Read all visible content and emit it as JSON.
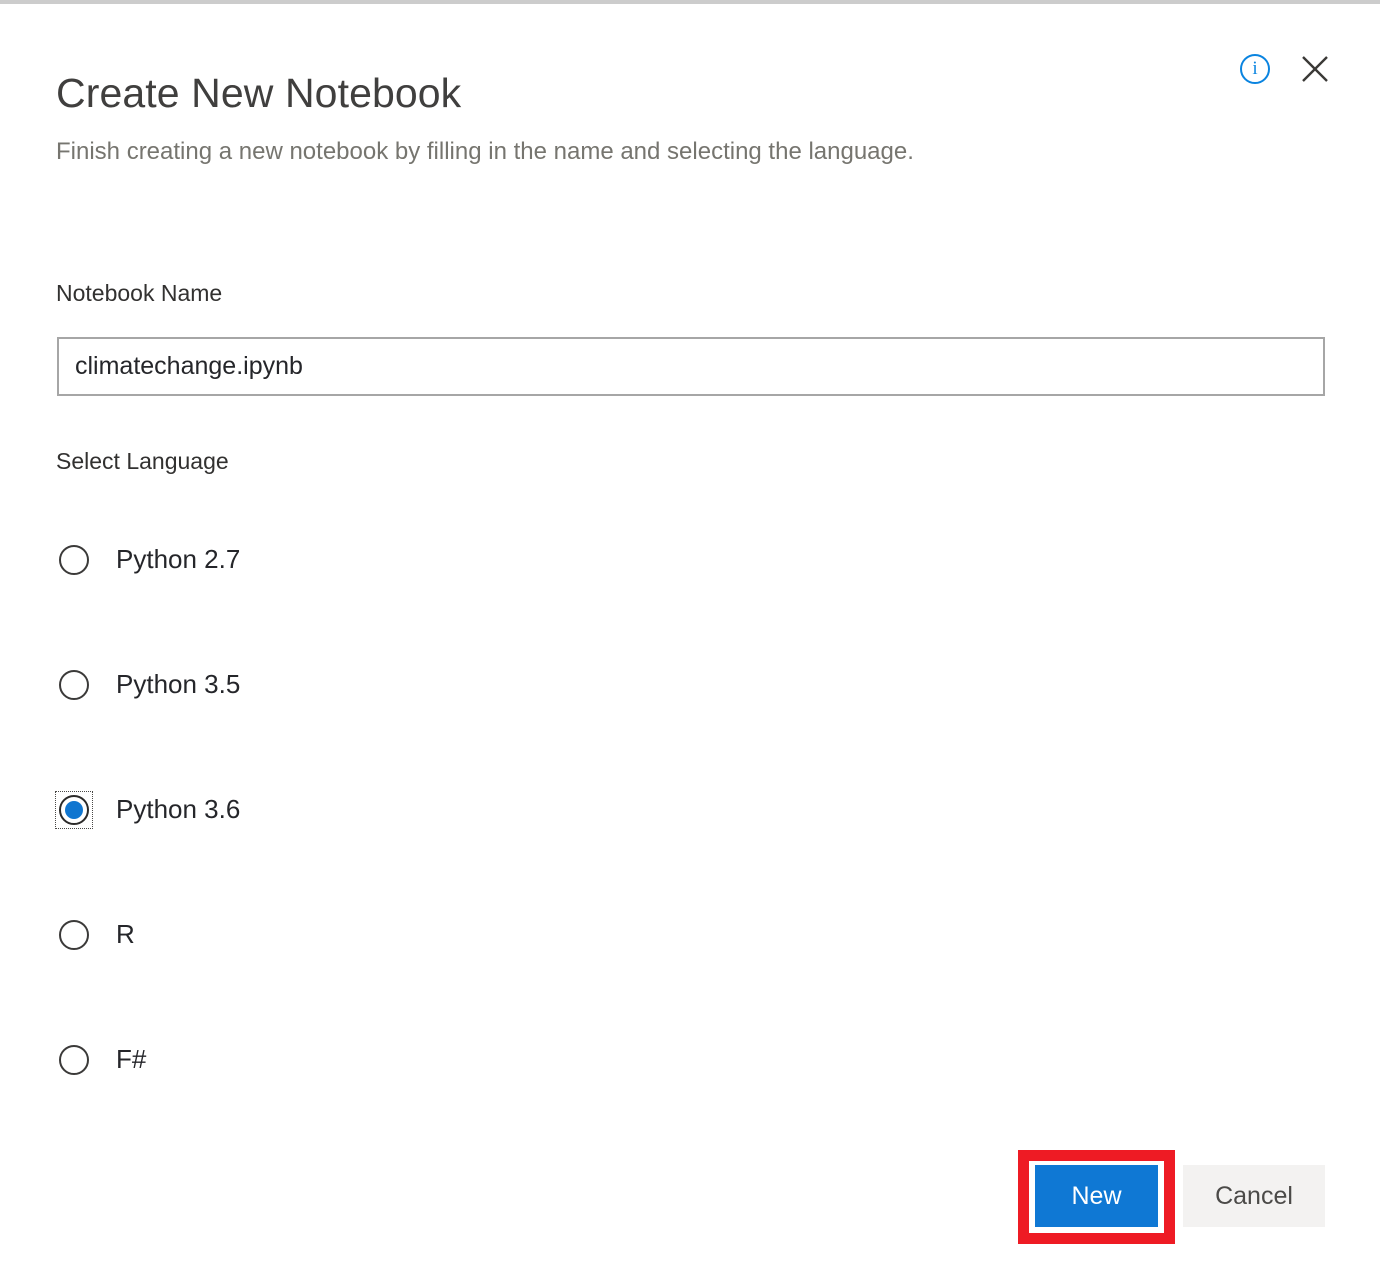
{
  "dialog": {
    "title": "Create New Notebook",
    "subtitle": "Finish creating a new notebook by filling in the name and selecting the language."
  },
  "header": {
    "info_icon": "info-icon",
    "info_glyph": "i",
    "close_icon": "close-icon"
  },
  "form": {
    "name_label": "Notebook Name",
    "name_value": "climatechange.ipynb",
    "name_placeholder": "Notebook Name",
    "language_label": "Select Language",
    "languages": [
      {
        "label": "Python 2.7",
        "selected": false
      },
      {
        "label": "Python 3.5",
        "selected": false
      },
      {
        "label": "Python 3.6",
        "selected": true
      },
      {
        "label": "R",
        "selected": false
      },
      {
        "label": "F#",
        "selected": false
      }
    ],
    "selected_language": "Python 3.6"
  },
  "footer": {
    "primary_label": "New",
    "secondary_label": "Cancel"
  },
  "colors": {
    "accent_blue": "#0f78d4",
    "info_blue": "#0a84e0",
    "highlight_red": "#ee1b24",
    "cancel_bg": "#f3f2f1",
    "subtitle_gray": "#76756f"
  }
}
